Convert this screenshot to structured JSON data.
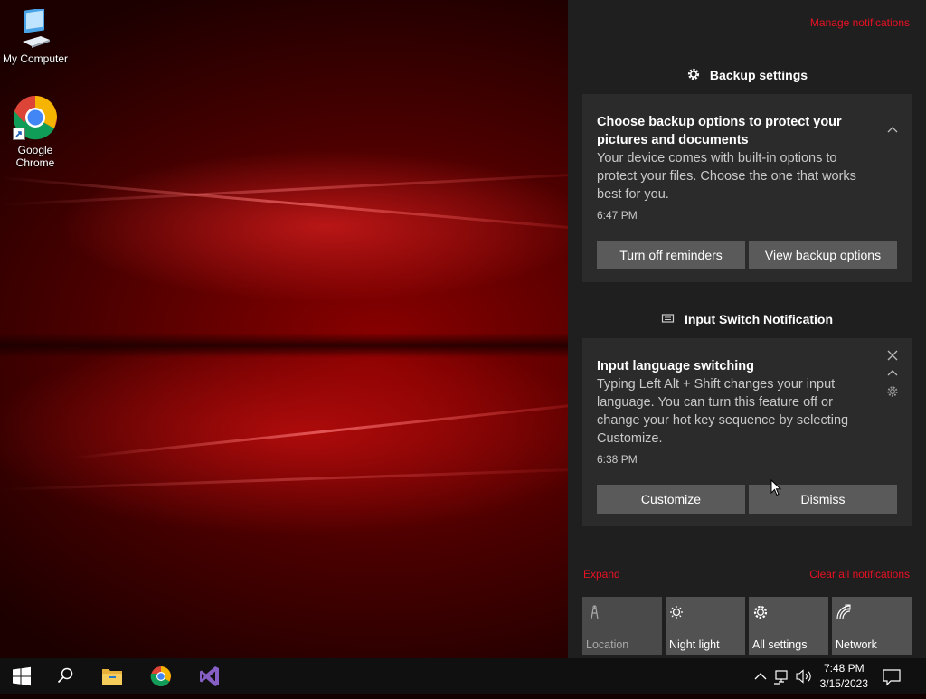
{
  "desktop": {
    "icons": [
      {
        "label": "My Computer"
      },
      {
        "label": "Google Chrome"
      }
    ]
  },
  "action_center": {
    "manage_notifications": "Manage notifications",
    "groups": [
      {
        "app": "Backup settings",
        "title": "Choose backup options to protect your pictures and documents",
        "body": "Your device comes with built-in options to protect your files. Choose the one that works best for you.",
        "time": "6:47 PM",
        "buttons": [
          "Turn off reminders",
          "View backup options"
        ]
      },
      {
        "app": "Input Switch Notification",
        "title": "Input language switching",
        "body": "Typing Left Alt + Shift changes your input language. You can turn this feature off or change your hot key sequence by selecting Customize.",
        "time": "6:38 PM",
        "buttons": [
          "Customize",
          "Dismiss"
        ]
      }
    ],
    "expand": "Expand",
    "clear_all": "Clear all notifications",
    "quick_actions": [
      {
        "label": "Location",
        "icon": "location-icon",
        "state": "off"
      },
      {
        "label": "Night light",
        "icon": "night-light-icon",
        "state": "available"
      },
      {
        "label": "All settings",
        "icon": "gear-icon",
        "state": "available"
      },
      {
        "label": "Network",
        "icon": "network-icon",
        "state": "available"
      }
    ]
  },
  "taskbar": {
    "time": "7:48 PM",
    "date": "3/15/2023"
  },
  "colors": {
    "accent": "#e81123",
    "action_center_bg": "#1f1f1f",
    "card_bg": "#2b2b2b",
    "button_bg": "#5a5a5a",
    "taskbar_bg": "#101010"
  }
}
